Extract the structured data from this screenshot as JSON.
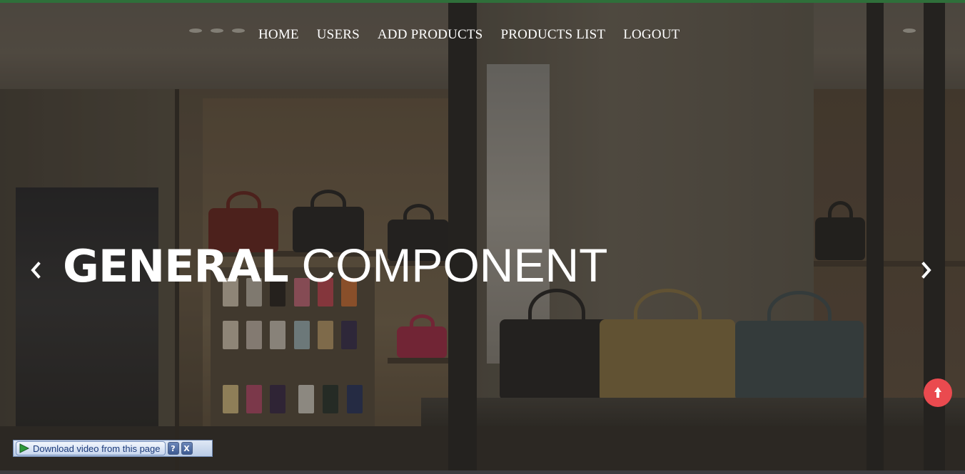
{
  "nav": {
    "items": [
      {
        "label": "HOME"
      },
      {
        "label": "USERS"
      },
      {
        "label": "ADD PRODUCTS"
      },
      {
        "label": "PRODUCTS LIST"
      },
      {
        "label": "LOGOUT"
      }
    ]
  },
  "hero": {
    "title_bold": "GENERAL",
    "title_light": "COMPONENT",
    "prev_icon": "chevron-left-icon",
    "next_icon": "chevron-right-icon"
  },
  "scroll_top": {
    "icon": "arrow-up-icon",
    "color": "#ea4a4f"
  },
  "download_toolbar": {
    "button_label": "Download video from this page",
    "help_label": "?",
    "close_label": "X"
  },
  "colors": {
    "accent_top": "#2f6f3a",
    "nav_text": "#ffffff"
  }
}
